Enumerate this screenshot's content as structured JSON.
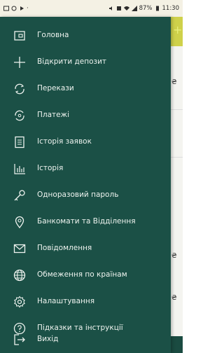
{
  "status_bar": {
    "battery": "87%",
    "time": "11:30"
  },
  "menu": {
    "items": [
      {
        "label": "Головна",
        "icon": "home-card-icon"
      },
      {
        "label": "Відкрити депозит",
        "icon": "plus-icon"
      },
      {
        "label": "Перекази",
        "icon": "transfer-icon"
      },
      {
        "label": "Платежі",
        "icon": "payments-icon"
      },
      {
        "label": "Історія заявок",
        "icon": "document-icon"
      },
      {
        "label": "Історія",
        "icon": "bar-chart-icon"
      },
      {
        "label": "Одноразовий пароль",
        "icon": "key-icon"
      },
      {
        "label": "Банкомати та Відділення",
        "icon": "location-pin-icon"
      },
      {
        "label": "Повідомлення",
        "icon": "envelope-icon"
      },
      {
        "label": "Обмеження по країнам",
        "icon": "globe-icon"
      },
      {
        "label": "Налаштування",
        "icon": "gear-icon"
      },
      {
        "label": "Підказки та інструкції",
        "icon": "help-icon"
      },
      {
        "label": "Вихід",
        "icon": "logout-icon"
      }
    ]
  },
  "colors": {
    "drawer": "#1b5046",
    "text": "#eef3ef",
    "accent": "#cfd14a"
  }
}
